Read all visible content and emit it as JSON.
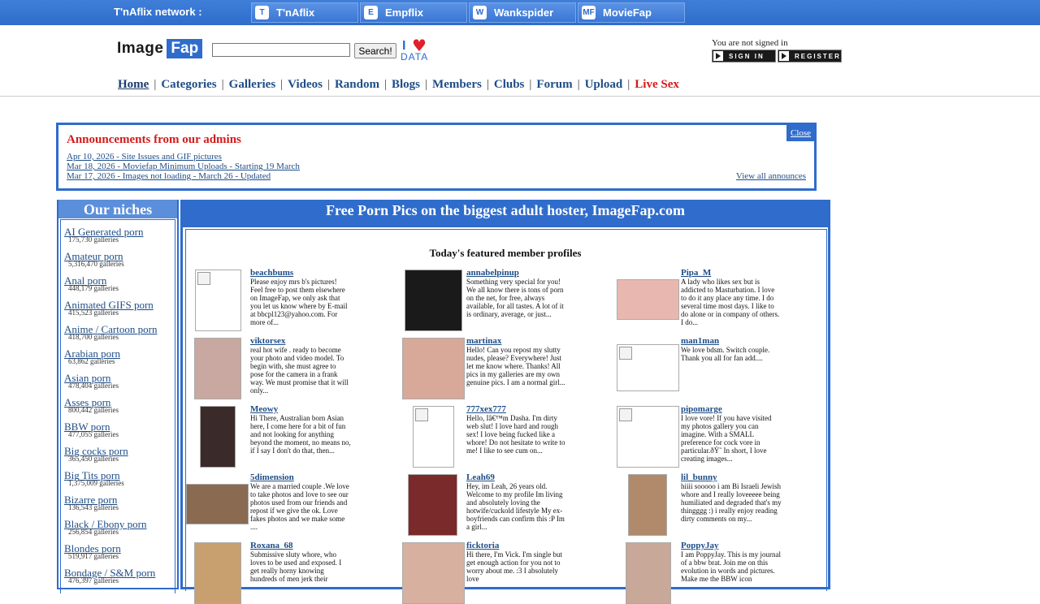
{
  "network": {
    "label": "T'nAflix network :",
    "tabs": [
      {
        "label": "T'nAflix",
        "icon": "tnaflix-icon",
        "glyph": "T"
      },
      {
        "label": "Empflix",
        "icon": "empflix-icon",
        "glyph": "E"
      },
      {
        "label": "Wankspider",
        "icon": "wankspider-icon",
        "glyph": "W"
      },
      {
        "label": "MovieFap",
        "icon": "moviefap-icon",
        "glyph": "MF"
      }
    ]
  },
  "header": {
    "logo_text": "Image",
    "logo_accent": "Fap",
    "search_value": "",
    "search_button": "Search!",
    "idata_text": "DATA",
    "idata_i": "I",
    "signin_text": "You are not signed in",
    "signin_button": "SIGN IN",
    "register_button": "REGISTER"
  },
  "nav": {
    "items": [
      "Home",
      "Categories",
      "Galleries",
      "Videos",
      "Random",
      "Blogs",
      "Members",
      "Clubs",
      "Forum",
      "Upload",
      "Live Sex"
    ],
    "separator": "|"
  },
  "announcements": {
    "title": "Announcements from our admins",
    "close": "Close",
    "items": [
      "Apr 10, 2026 - Site Issues and GIF pictures",
      "Mar 18, 2026 - Moviefap Minimum Uploads - Starting 19 March",
      "Mar 17, 2026 - Images not loading - March 26 - Updated"
    ],
    "view_all": "View all announces"
  },
  "niches": {
    "title": "Our niches",
    "items": [
      {
        "name": "AI Generated porn",
        "count": "175,730 galleries"
      },
      {
        "name": "Amateur porn",
        "count": "5,316,470 galleries"
      },
      {
        "name": "Anal porn",
        "count": "448,179 galleries"
      },
      {
        "name": "Animated GIFS porn",
        "count": "415,523 galleries"
      },
      {
        "name": "Anime / Cartoon porn",
        "count": "418,700 galleries"
      },
      {
        "name": "Arabian porn",
        "count": "63,862 galleries"
      },
      {
        "name": "Asian porn",
        "count": "478,404 galleries"
      },
      {
        "name": "Asses porn",
        "count": "800,442 galleries"
      },
      {
        "name": "BBW porn",
        "count": "477,055 galleries"
      },
      {
        "name": "Big cocks porn",
        "count": "365,450 galleries"
      },
      {
        "name": "Big Tits porn",
        "count": "1,375,009 galleries"
      },
      {
        "name": "Bizarre porn",
        "count": "136,543 galleries"
      },
      {
        "name": "Black / Ebony porn",
        "count": "256,854 galleries"
      },
      {
        "name": "Blondes porn",
        "count": "519,917 galleries"
      },
      {
        "name": "Bondage / S&M porn",
        "count": "476,397 galleries"
      }
    ]
  },
  "main": {
    "title": "Free Porn Pics on the biggest adult hoster, ImageFap.com",
    "featured_title": "Today's featured member profiles",
    "profiles": [
      {
        "name": "beachbums",
        "desc": "Please enjoy mrs b's pictures! Feel free to post them elsewhere on ImageFap, we only ask that you let us know where by E-mail at bbcpl123@yahoo.com. For more of...",
        "color": "#ffffff"
      },
      {
        "name": "annabelpinup",
        "desc": "Something very special for you! We all know there is tons of porn on the net, for free, always available, for all tastes. A lot of it is ordinary, average, or just...",
        "color": "#1a1a1a"
      },
      {
        "name": "Pipa_M",
        "desc": "A lady who likes sex but is addicted to Masturbation. I love to do it any place any time. I do several time most days. I like to do alone or in company of others. I do...",
        "color": "#e8b8b0"
      },
      {
        "name": "viktorsex",
        "desc": "real hot wife . ready to become your photo and video model. To begin with, she must agree to pose for the camera in a frank way. We must promise that it will only...",
        "color": "#c8a8a0"
      },
      {
        "name": "martinax",
        "desc": "Hello! Can you repost my slutty nudes, please? Everywhere! Just let me know where. Thanks! All pics in my galleries are my own genuine pics. I am a normal girl...",
        "color": "#d8a898"
      },
      {
        "name": "man1man",
        "desc": "We love bdsm. Switch couple. Thank you all for fan add....",
        "color": "#ffffff"
      },
      {
        "name": "Meowy",
        "desc": "Hi There, Australian born Asian here, I come here for a bit of fun and not looking for anything beyond the moment, no means no, if I say I don't do that, then...",
        "color": "#3a2a2a"
      },
      {
        "name": "777xex777",
        "desc": "Hello, Iâ€™m Dasha. I'm dirty web slut! I love hard and rough sex! I love being fucked like a whore! Do not hesitate to write to me! I like to see cum on...",
        "color": "#ffffff"
      },
      {
        "name": "pipomarge",
        "desc": "I love vore! If you have visited my photos gallery you can imagine. With a SMALL preference for cock vore in particular.ðŸ˜ In short, I love creating images...",
        "color": "#ffffff"
      },
      {
        "name": "5dimension",
        "desc": "We are a married couple .We love to take photos and love to see our photos used from our friends and repost if we give the ok. Love fakes photos and we make some ....",
        "color": "#8a6a50"
      },
      {
        "name": "Leah69",
        "desc": "Hey, im Leah, 26 years old. Welcome to my profile Im living and absolutely loving the hotwife/cuckold lifestyle My ex-boyfriends can confirm this :P Im a girl...",
        "color": "#7a2a2a"
      },
      {
        "name": "lil_bunny",
        "desc": "hiiii sooooo i am Bi Israeli Jewish whore and I really loveeeee being humiliated and degraded that's my thingggg :) i really enjoy reading dirty comments on my...",
        "color": "#b08a6a"
      },
      {
        "name": "Roxana_68",
        "desc": "Submissive sluty whore, who loves to be used and exposed. I get really horny knowing hundreds of men jerk their",
        "color": "#c8a070"
      },
      {
        "name": "ficktoria",
        "desc": "Hi there, I'm Vick. I'm single but get enough action for you not to worry about me. :3 I absolutely love",
        "color": "#d8b0a0"
      },
      {
        "name": "PoppyJay",
        "desc": "I am PoppyJay. This is my journal of a bbw brat. Join me on this evolution in words and pictures. Make me the BBW icon",
        "color": "#c8a898"
      }
    ]
  }
}
